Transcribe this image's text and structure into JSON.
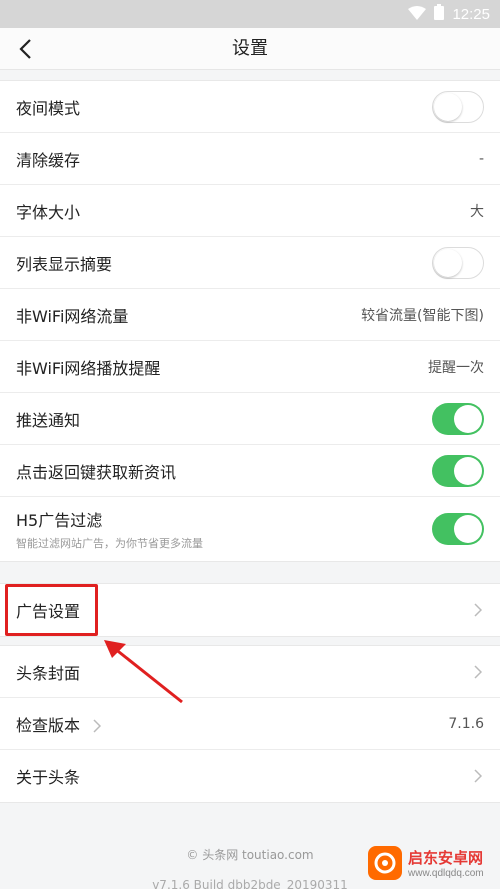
{
  "status": {
    "time": "12:25"
  },
  "nav": {
    "title": "设置"
  },
  "settings_group": [
    {
      "label": "夜间模式",
      "control": "toggle",
      "state": "off"
    },
    {
      "label": "清除缓存",
      "control": "value",
      "value": "-"
    },
    {
      "label": "字体大小",
      "control": "value",
      "value": "大"
    },
    {
      "label": "列表显示摘要",
      "control": "toggle",
      "state": "off"
    },
    {
      "label": "非WiFi网络流量",
      "control": "value",
      "value": "较省流量(智能下图)"
    },
    {
      "label": "非WiFi网络播放提醒",
      "control": "value",
      "value": "提醒一次"
    },
    {
      "label": "推送通知",
      "control": "toggle",
      "state": "on"
    },
    {
      "label": "点击返回键获取新资讯",
      "control": "toggle",
      "state": "on"
    },
    {
      "label": "H5广告过滤",
      "sublabel": "智能过滤网站广告，为你节省更多流量",
      "control": "toggle",
      "state": "on"
    }
  ],
  "ad_group": {
    "label": "广告设置"
  },
  "about_group": [
    {
      "label": "头条封面"
    },
    {
      "label": "检查版本",
      "value": "7.1.6"
    },
    {
      "label": "关于头条"
    }
  ],
  "footer": {
    "copyright": "© 头条网 toutiao.com",
    "version": "v7.1.6 Build dbb2bde_20190311"
  },
  "watermark": {
    "name": "启东安卓网",
    "url": "www.qdlqdq.com"
  },
  "colors": {
    "toggle_on": "#43c161",
    "highlight": "#e02020"
  }
}
